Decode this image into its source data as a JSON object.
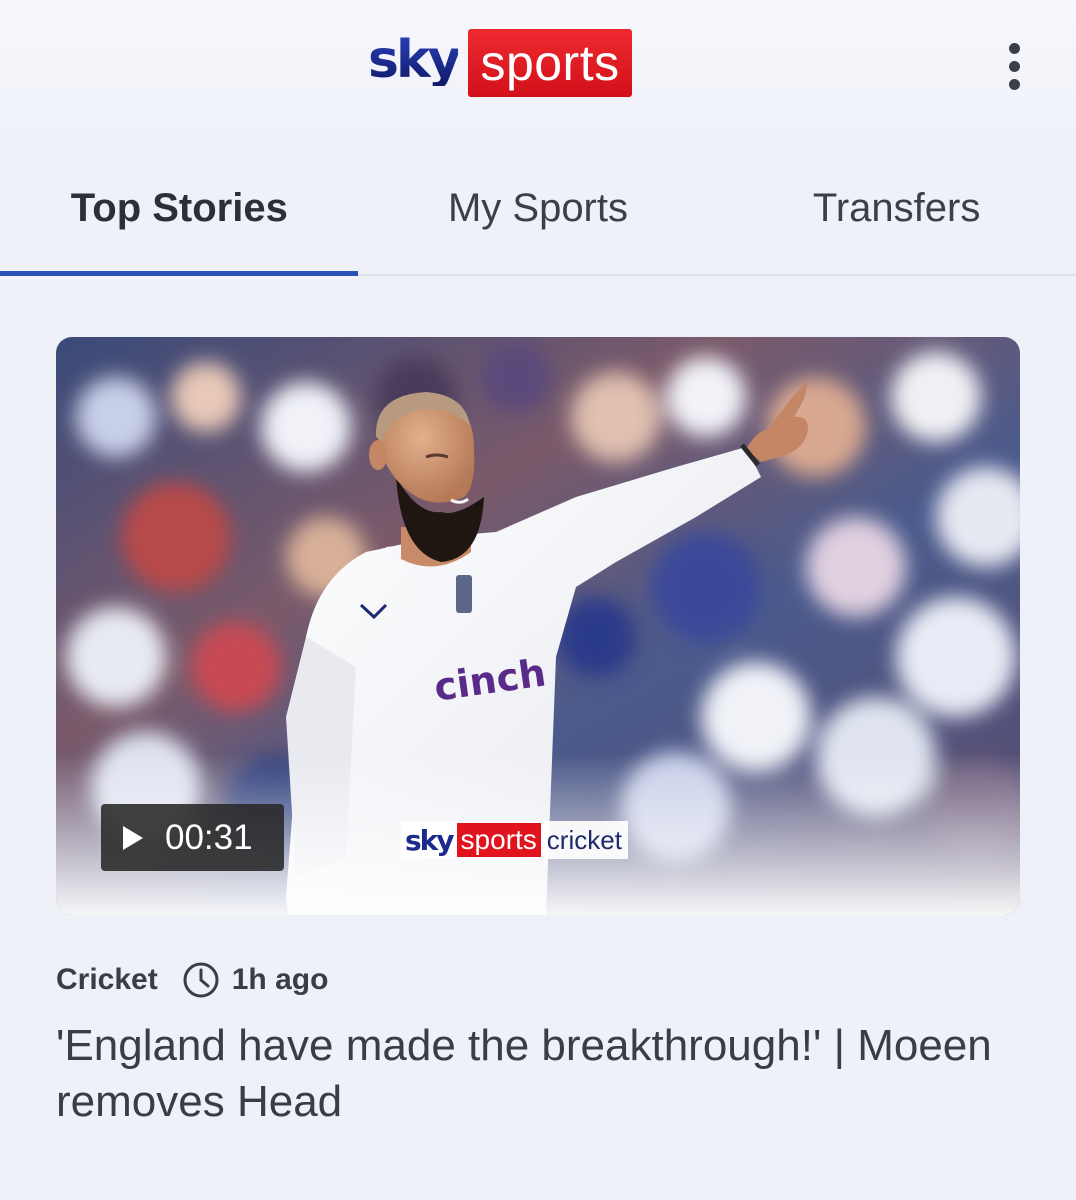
{
  "header": {
    "logo_sky": "sky",
    "logo_sports": "sports",
    "menu_icon": "more-vertical-icon"
  },
  "tabs": [
    {
      "label": "Top Stories",
      "active": true
    },
    {
      "label": "My Sports",
      "active": false
    },
    {
      "label": "Transfers",
      "active": false
    }
  ],
  "story": {
    "video_duration": "00:31",
    "play_icon": "play-icon",
    "broadcast_logo": {
      "sky": "sky",
      "sports": "sports",
      "channel": "cricket"
    },
    "shirt_sponsor": "cinch",
    "category": "Cricket",
    "clock_icon": "clock-icon",
    "time_ago": "1h ago",
    "headline": "'England have made the breakthrough!' | Moeen removes Head"
  },
  "colors": {
    "background": "#eef1f8",
    "brand_red": "#e1141e",
    "brand_blue": "#1b2a8e",
    "tab_indicator": "#2c4fb8",
    "text": "#3a3d45"
  }
}
